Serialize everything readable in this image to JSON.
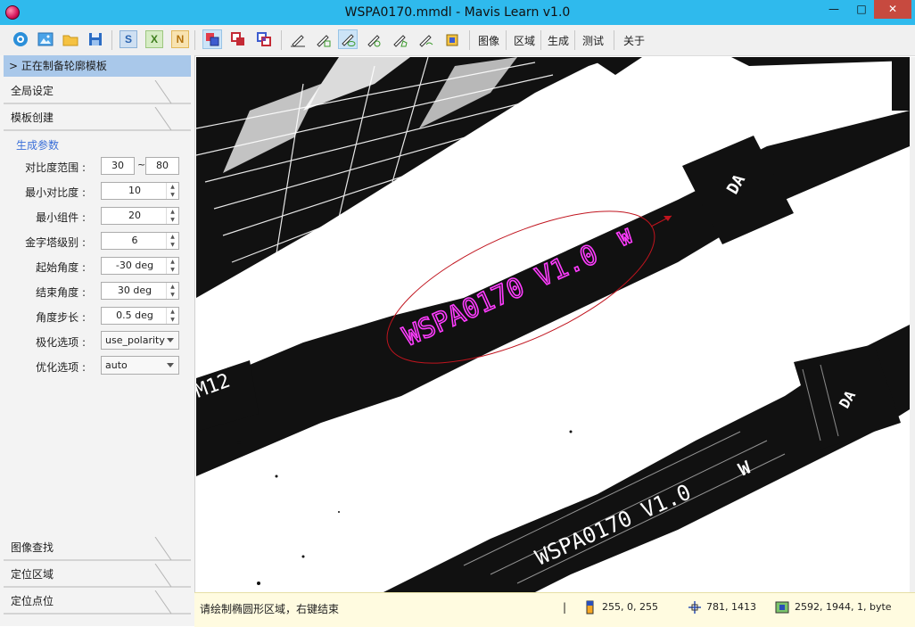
{
  "window": {
    "title": "WSPA0170.mmdl - Mavis Learn v1.0",
    "minimize_glyph": "—",
    "maximize_glyph": "□",
    "close_glyph": "✕"
  },
  "toolbar": {
    "letter_buttons": {
      "s": "S",
      "x": "X",
      "n": "N"
    },
    "menu": {
      "image": "图像",
      "region": "区域",
      "generate": "生成",
      "test": "测试",
      "about": "关于"
    }
  },
  "sidebar": {
    "active_section": "> 正在制备轮廓模板",
    "sections": {
      "global": "全局设定",
      "template": "模板创建",
      "image_search": "图像查找",
      "locate_region": "定位区域",
      "locate_point": "定位点位"
    },
    "params_title": "生成参数",
    "contrast": {
      "label": "对比度范围 :",
      "min": "30",
      "tilde": "~",
      "max": "80"
    },
    "fields": {
      "min_contrast": {
        "label": "最小对比度 :",
        "value": "10"
      },
      "min_component": {
        "label": "最小组件 :",
        "value": "20"
      },
      "pyramid": {
        "label": "金字塔级别 :",
        "value": "6"
      },
      "start_angle": {
        "label": "起始角度 :",
        "value": "-30 deg"
      },
      "end_angle": {
        "label": "结束角度 :",
        "value": "30 deg"
      },
      "angle_step": {
        "label": "角度步长 :",
        "value": "0.5 deg"
      }
    },
    "selects": {
      "polarity": {
        "label": "极化选项 :",
        "value": "use_polarity"
      },
      "optimize": {
        "label": "优化选项 :",
        "value": "auto"
      }
    }
  },
  "canvas": {
    "text_upper": "WSPA0170 V1.0",
    "text_upper_logo": "W",
    "text_lower": "WSPA0170 V1.0",
    "text_lower_logo": "W",
    "text_left": "M12",
    "text_upper_pad": "DA",
    "text_lower_pad": "DA"
  },
  "status": {
    "message": "请绘制椭圆形区域，右键结束",
    "separator": "|",
    "pixel_value": "255, 0, 255",
    "coordinates": "781, 1413",
    "image_info": "2592, 1944, 1, byte"
  },
  "colors": {
    "titlebar": "#2fbaed",
    "active_section": "#a9c8ea",
    "ellipse": "#c0141e",
    "overlay_text": "#ff3cff",
    "params_title": "#3b6fd8"
  }
}
